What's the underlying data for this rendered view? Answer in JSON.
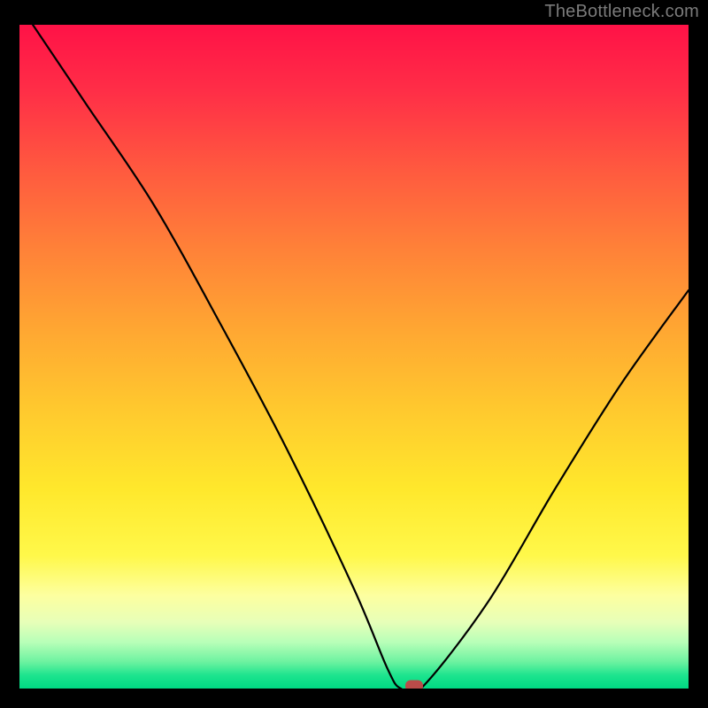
{
  "watermark": "TheBottleneck.com",
  "chart_data": {
    "type": "line",
    "title": "",
    "xlabel": "",
    "ylabel": "",
    "xlim": [
      0,
      100
    ],
    "ylim": [
      0,
      100
    ],
    "grid": false,
    "legend": false,
    "series": [
      {
        "name": "bottleneck-curve",
        "x": [
          2,
          10,
          20,
          30,
          40,
          50,
          55,
          57,
          60,
          70,
          80,
          90,
          100
        ],
        "values": [
          100,
          88,
          73,
          55,
          36,
          15,
          3,
          0,
          0,
          13,
          30,
          46,
          60
        ]
      }
    ],
    "marker": {
      "x": 59,
      "y": 0,
      "name": "optimal-point"
    },
    "gradient_stops": [
      {
        "pos": 0,
        "color": "#ff1247"
      },
      {
        "pos": 10,
        "color": "#ff2e47"
      },
      {
        "pos": 22,
        "color": "#ff5a3f"
      },
      {
        "pos": 34,
        "color": "#ff8238"
      },
      {
        "pos": 46,
        "color": "#ffa732"
      },
      {
        "pos": 58,
        "color": "#ffc92e"
      },
      {
        "pos": 70,
        "color": "#ffe82c"
      },
      {
        "pos": 80,
        "color": "#fff84a"
      },
      {
        "pos": 86,
        "color": "#fdffa0"
      },
      {
        "pos": 90,
        "color": "#e7ffb8"
      },
      {
        "pos": 93,
        "color": "#b8ffb8"
      },
      {
        "pos": 96,
        "color": "#6cf2a0"
      },
      {
        "pos": 98,
        "color": "#1de48e"
      },
      {
        "pos": 100,
        "color": "#00d983"
      }
    ]
  }
}
